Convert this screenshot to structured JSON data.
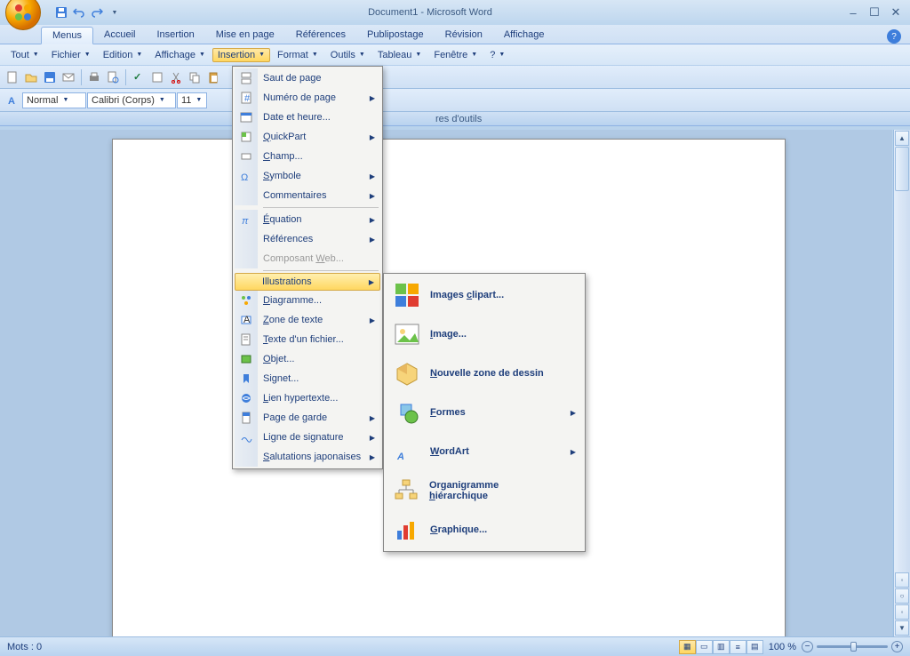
{
  "title": "Document1 - Microsoft Word",
  "tabs": [
    "Menus",
    "Accueil",
    "Insertion",
    "Mise en page",
    "Références",
    "Publipostage",
    "Révision",
    "Affichage"
  ],
  "activeTab": 0,
  "menuBar": [
    "Tout",
    "Fichier",
    "Edition",
    "Affichage",
    "Insertion",
    "Format",
    "Outils",
    "Tableau",
    "Fenêtre",
    "?"
  ],
  "activeMenu": 4,
  "style_combo": "Normal",
  "font_combo": "Calibri (Corps)",
  "size_combo": "11",
  "ribbonFooterText": "res d'outils",
  "dropdown1": {
    "items": [
      {
        "label": "Saut de page",
        "icon": "page-break",
        "arrow": false
      },
      {
        "label": "Numéro de page",
        "icon": "page-number",
        "arrow": true
      },
      {
        "label": "Date et heure...",
        "icon": "date-time",
        "arrow": false
      },
      {
        "label": "QuickPart",
        "icon": "quickpart",
        "arrow": true,
        "ul": "Q"
      },
      {
        "label": "Champ...",
        "icon": "field",
        "arrow": false,
        "ul": "C"
      },
      {
        "label": "Symbole",
        "icon": "symbol",
        "arrow": true,
        "ul": "S"
      },
      {
        "label": "Commentaires",
        "icon": "",
        "arrow": true
      },
      {
        "sep": true
      },
      {
        "label": "Équation",
        "icon": "equation",
        "arrow": true,
        "ul": "É"
      },
      {
        "label": "Références",
        "icon": "",
        "arrow": true
      },
      {
        "label": "Composant Web...",
        "icon": "",
        "ul": "W",
        "disabled": true
      },
      {
        "sep": true
      },
      {
        "label": "Illustrations",
        "icon": "",
        "arrow": true,
        "highlight": true
      },
      {
        "label": "Diagramme...",
        "icon": "diagram",
        "ul": "D"
      },
      {
        "label": "Zone de texte",
        "icon": "textbox",
        "arrow": true,
        "ul": "Z"
      },
      {
        "label": "Texte d'un fichier...",
        "icon": "text-file",
        "ul": "T"
      },
      {
        "label": "Objet...",
        "icon": "object",
        "ul": "O"
      },
      {
        "label": "Signet...",
        "icon": "bookmark"
      },
      {
        "label": "Lien hypertexte...",
        "icon": "hyperlink",
        "ul": "L"
      },
      {
        "label": "Page de garde",
        "icon": "cover-page",
        "arrow": true
      },
      {
        "label": "Ligne de signature",
        "icon": "signature",
        "arrow": true,
        "ul": "g"
      },
      {
        "label": "Salutations japonaises",
        "icon": "",
        "arrow": true,
        "ul": "S"
      }
    ]
  },
  "submenuItems": [
    {
      "label": "Images clipart...",
      "ul": "c",
      "icon": "clipart"
    },
    {
      "label": "Image...",
      "ul": "I",
      "icon": "image"
    },
    {
      "label": "Nouvelle zone de dessin",
      "ul": "N",
      "icon": "canvas"
    },
    {
      "label": "Formes",
      "ul": "F",
      "icon": "shapes",
      "arrow": true
    },
    {
      "label": "WordArt",
      "ul": "W",
      "icon": "wordart",
      "arrow": true
    },
    {
      "label": "Organigramme hiérarchique",
      "ul": "h",
      "icon": "orgchart"
    },
    {
      "label": "Graphique...",
      "ul": "G",
      "icon": "chart"
    }
  ],
  "status": {
    "words": "Mots : 0",
    "zoom": "100 %"
  }
}
